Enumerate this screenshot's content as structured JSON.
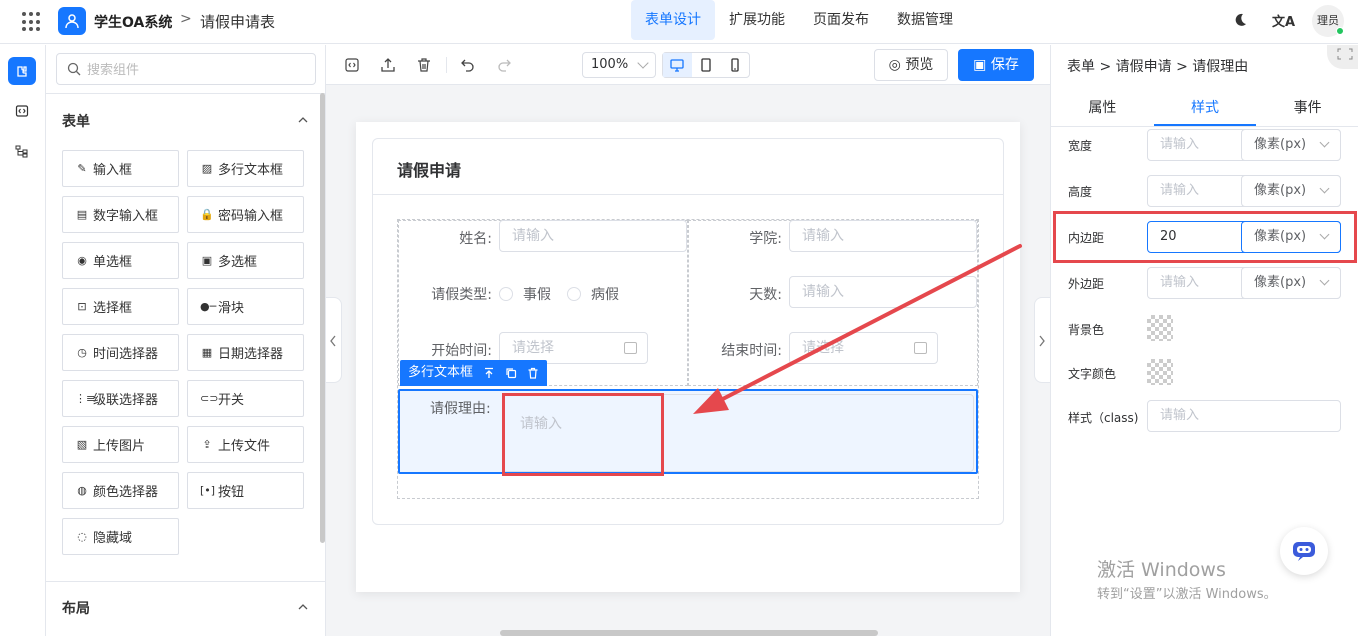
{
  "header": {
    "app_name": "学生OA系统",
    "separator": ">",
    "page_title": "请假申请表",
    "tabs": [
      "表单设计",
      "扩展功能",
      "页面发布",
      "数据管理"
    ],
    "translate_glyph": "文A",
    "user": "理员"
  },
  "components": {
    "search_placeholder": "搜索组件",
    "section_form": "表单",
    "items": [
      {
        "label": "输入框",
        "icon": "✎"
      },
      {
        "label": "多行文本框",
        "icon": "▨"
      },
      {
        "label": "数字输入框",
        "icon": "▤"
      },
      {
        "label": "密码输入框",
        "icon": "🔒"
      },
      {
        "label": "单选框",
        "icon": "◉"
      },
      {
        "label": "多选框",
        "icon": "▣"
      },
      {
        "label": "选择框",
        "icon": "⊡"
      },
      {
        "label": "滑块",
        "icon": "●─"
      },
      {
        "label": "时间选择器",
        "icon": "◷"
      },
      {
        "label": "日期选择器",
        "icon": "▦"
      },
      {
        "label": "级联选择器",
        "icon": "⋮≡"
      },
      {
        "label": "开关",
        "icon": "⊂⊃"
      },
      {
        "label": "上传图片",
        "icon": "▧"
      },
      {
        "label": "上传文件",
        "icon": "⇪"
      },
      {
        "label": "颜色选择器",
        "icon": "◍"
      },
      {
        "label": "按钮",
        "icon": "[•]"
      },
      {
        "label": "隐藏域",
        "icon": "◌"
      }
    ],
    "section_layout": "布局"
  },
  "toolbar": {
    "zoom": "100%",
    "preview_label": "预览",
    "save_label": "保存"
  },
  "form": {
    "title": "请假申请",
    "name_label": "姓名:",
    "name_placeholder": "请输入",
    "college_label": "学院:",
    "college_placeholder": "请输入",
    "type_label": "请假类型:",
    "type_options": [
      "事假",
      "病假"
    ],
    "days_label": "天数:",
    "days_placeholder": "请输入",
    "start_label": "开始时间:",
    "start_placeholder": "请选择",
    "end_label": "结束时间:",
    "end_placeholder": "请选择",
    "selected_component": "多行文本框",
    "reason_label": "请假理由:",
    "reason_placeholder": "请输入"
  },
  "props": {
    "breadcrumb": [
      "表单",
      "请假申请",
      "请假理由"
    ],
    "tabs": [
      "属性",
      "样式",
      "事件"
    ],
    "active_tab": "样式",
    "width_label": "宽度",
    "height_label": "高度",
    "padding_label": "内边距",
    "margin_label": "外边距",
    "bg_label": "背景色",
    "text_color_label": "文字颜色",
    "class_label": "样式（class)",
    "input_placeholder": "请输入",
    "padding_value": "20",
    "unit": "像素(px)"
  },
  "watermark": {
    "line1": "激活 Windows",
    "line2": "转到“设置”以激活 Windows。"
  },
  "colors": {
    "primary": "#1677ff",
    "annotation_red": "#e5484d"
  }
}
